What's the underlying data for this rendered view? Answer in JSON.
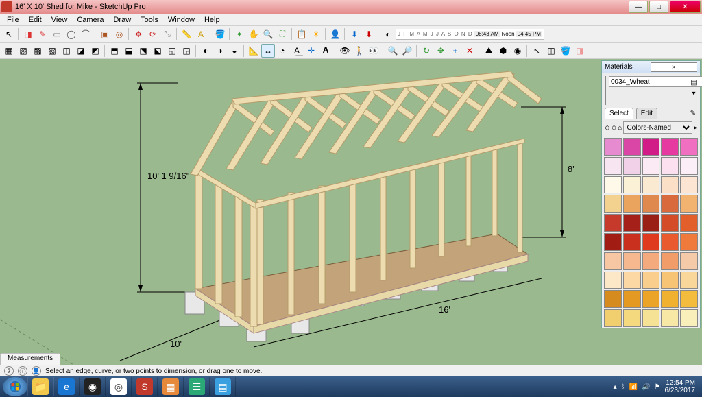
{
  "window": {
    "title": "16' X 10' Shed for Mike - SketchUp Pro",
    "min": "—",
    "max": "□",
    "close": "✕"
  },
  "menu": [
    "File",
    "Edit",
    "View",
    "Camera",
    "Draw",
    "Tools",
    "Window",
    "Help"
  ],
  "shadow": {
    "months": "J F M A M J J A S O N D",
    "t1": "08:43 AM",
    "noon": "Noon",
    "t2": "04:45 PM"
  },
  "viewport": {
    "dim_height": "10' 1 9/16\"",
    "dim_eave": "8'",
    "dim_width": "10'",
    "dim_length": "16'"
  },
  "materials": {
    "title": "Materials",
    "swatch_name": "0034_Wheat",
    "tab_select": "Select",
    "tab_edit": "Edit",
    "library": "Colors-Named",
    "colors": [
      "#e78bd1",
      "#d946a6",
      "#d11b86",
      "#e63aa0",
      "#f06fc0",
      "#f7e6f2",
      "#f1d1e8",
      "#fbeaf3",
      "#fde0ef",
      "#fceef6",
      "#fef9e8",
      "#faf1d6",
      "#faead1",
      "#fbe0c7",
      "#fde5d4",
      "#f3d18f",
      "#eaa45d",
      "#e0894e",
      "#d96a3e",
      "#f2b371",
      "#c63a2c",
      "#a52019",
      "#9a1f14",
      "#d44b27",
      "#e25f2b",
      "#a11d14",
      "#c9301e",
      "#e03a1e",
      "#ea5a2f",
      "#ef7a3c",
      "#f7c6a3",
      "#f6b88f",
      "#f4aa7c",
      "#f29c6a",
      "#f5caa8",
      "#fce7c6",
      "#fcd9a4",
      "#facf8e",
      "#f7c374",
      "#f9d79a",
      "#d68b1e",
      "#e49a22",
      "#eba428",
      "#f0b030",
      "#f3bc3d",
      "#f1cf6e",
      "#f4d97f",
      "#f6e294",
      "#f7e8a6",
      "#f9efbb"
    ]
  },
  "status": {
    "measurements_tab": "Measurements",
    "hint": "Select an edge, curve, or two points to dimension, or drag one to move."
  },
  "taskbar": {
    "time": "12:54 PM",
    "date": "6/23/2017"
  }
}
